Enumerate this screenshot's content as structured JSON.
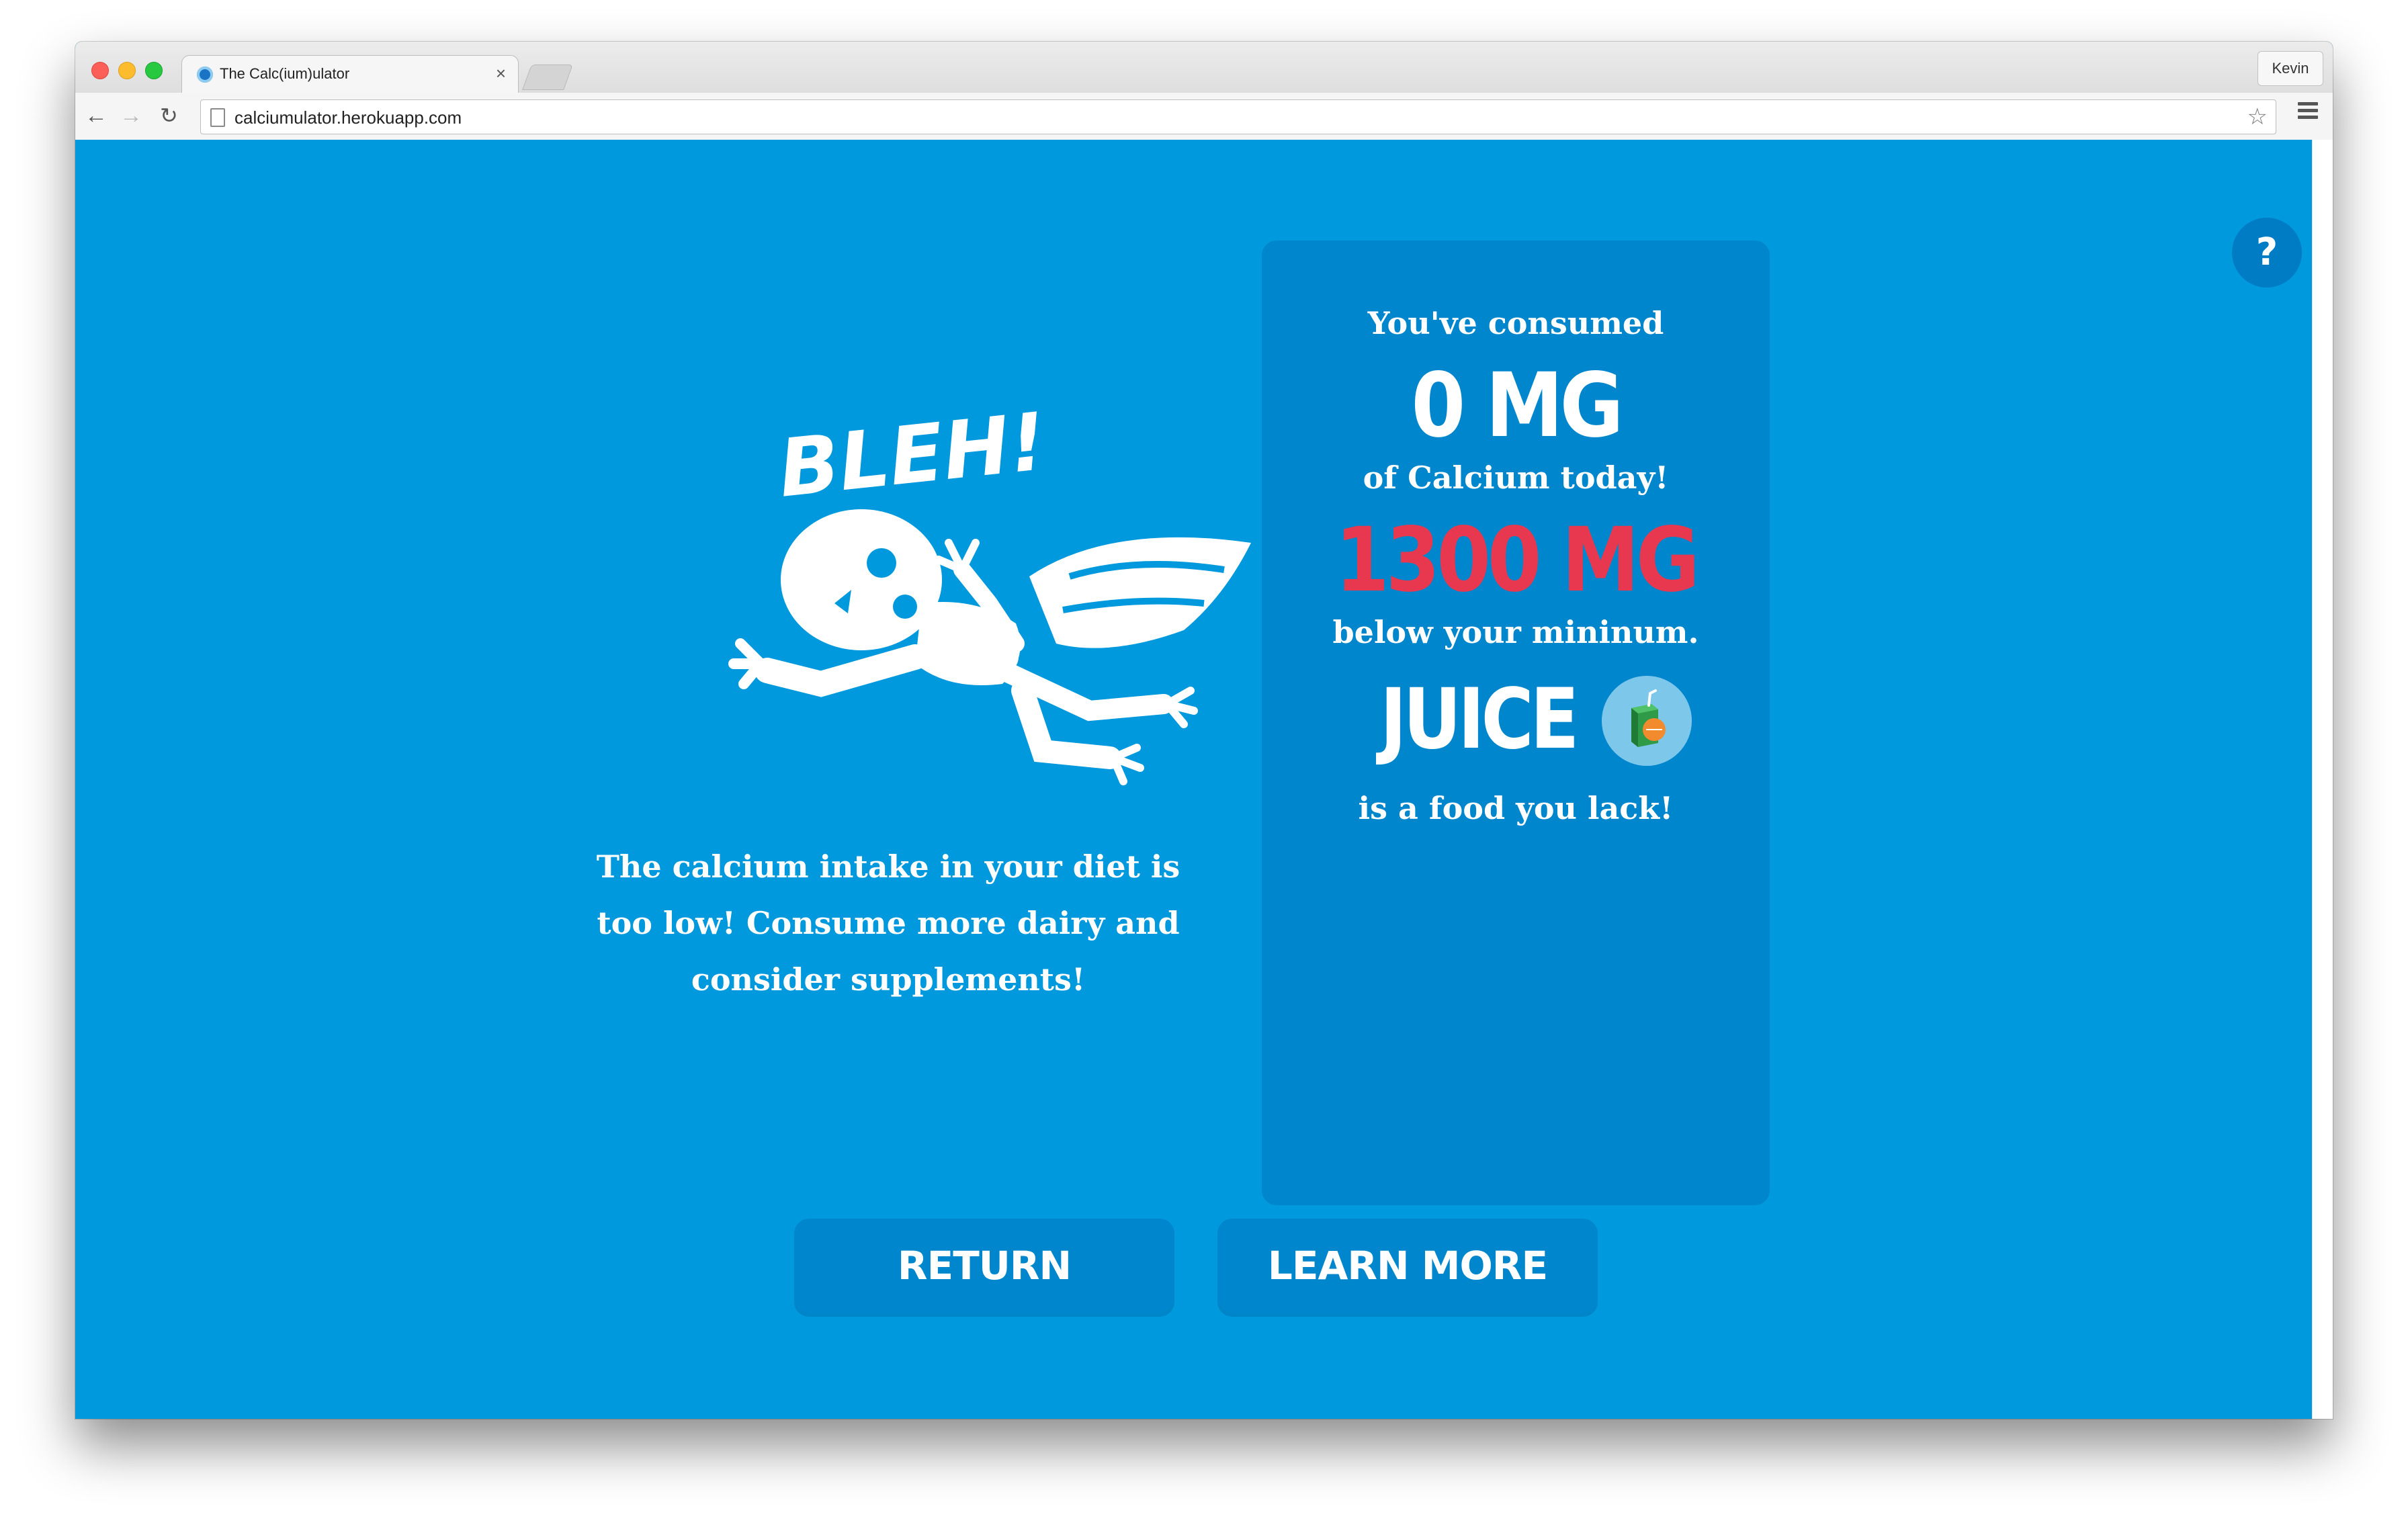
{
  "browser": {
    "tab_title": "The Calc(ium)ulator",
    "tab_close": "×",
    "profile_name": "Kevin",
    "url": "calciumulator.herokuapp.com",
    "nav": {
      "back": "←",
      "forward": "→",
      "reload": "↻",
      "bookmark": "☆"
    }
  },
  "page": {
    "help_label": "?",
    "exclamation": "BLEH!",
    "message": "The calcium intake in your diet is too low! Consume more dairy and consider supplements!",
    "panel": {
      "consumed_label": "You've consumed",
      "consumed_value": "0 MG",
      "calcium_label": "of Calcium today!",
      "deficit_value": "1300 MG",
      "deficit_label": "below your mininum.",
      "food_name": "JUICE",
      "food_label": "is a food you lack!"
    },
    "buttons": {
      "return_label": "RETURN",
      "learn_more_label": "LEARN MORE"
    }
  },
  "colors": {
    "background": "#0099dd",
    "panel": "#0086cc",
    "deficit": "#e8384f",
    "text": "#ffffff"
  }
}
